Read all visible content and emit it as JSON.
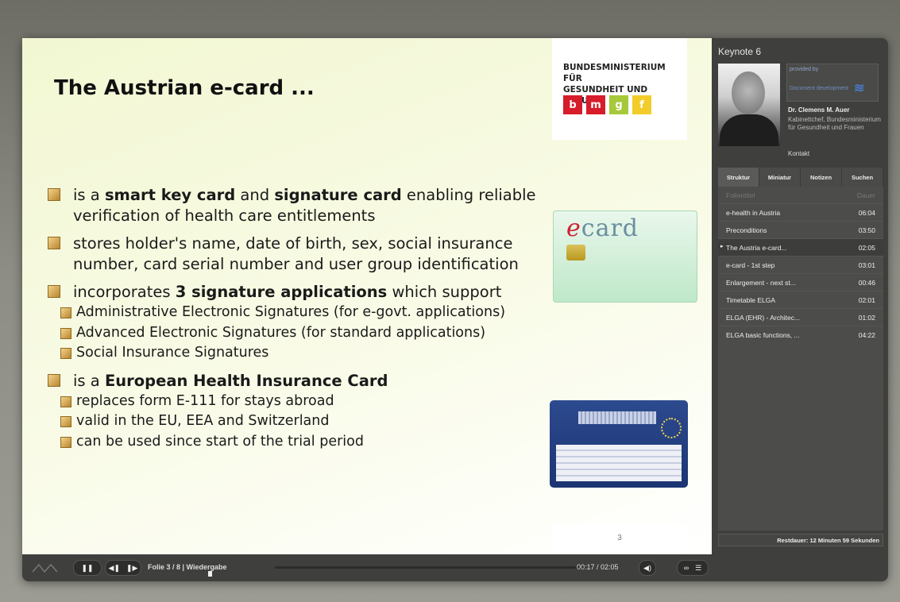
{
  "slide": {
    "title": "The Austrian e-card ...",
    "logo": {
      "line1": "BUNDESMINISTERIUM FÜR",
      "line2": "GESUNDHEIT UND FRAUEN",
      "letters": [
        {
          "t": "b",
          "color": "#d71c2a"
        },
        {
          "t": "m",
          "color": "#d71c2a"
        },
        {
          "t": "g",
          "color": "#a6c93a"
        },
        {
          "t": "f",
          "color": "#f2cc2a"
        }
      ]
    },
    "ecard_logo_e": "e",
    "ecard_logo_rest": "card",
    "page_number": "3",
    "bullets": [
      {
        "parts": [
          {
            "t": "is a "
          },
          {
            "t": "smart key card",
            "b": true
          },
          {
            "t": " and "
          },
          {
            "t": "signature card",
            "b": true
          },
          {
            "t": " enabling reliable verification of health care entitlements"
          }
        ],
        "subs": []
      },
      {
        "parts": [
          {
            "t": "stores holder's name, date of birth, sex, social insurance number, card serial number and user group identification"
          }
        ],
        "subs": []
      },
      {
        "parts": [
          {
            "t": "incorporates "
          },
          {
            "t": "3 signature applications",
            "b": true
          },
          {
            "t": " which support"
          }
        ],
        "subs": [
          "Administrative Electronic Signatures (for e-govt. applications)",
          "Advanced Electronic Signatures (for standard applications)",
          "Social Insurance Signatures"
        ]
      },
      {
        "parts": [
          {
            "t": "is a "
          },
          {
            "t": "European Health Insurance Card",
            "b": true
          }
        ],
        "subs": [
          "replaces form E-111 for stays abroad",
          "valid in the EU, EEA and Switzerland",
          "can be used since start of the trial period"
        ]
      }
    ]
  },
  "controls": {
    "slide_info": "Folie 3 / 8 | Wiedergabe",
    "time": "00:17 / 02:05",
    "pause_icon": "pause-icon",
    "prev_icon": "prev-icon",
    "next_icon": "next-icon",
    "volume_icon": "volume-icon",
    "link_icon": "link-icon",
    "menu_icon": "menu-icon",
    "logo_icon": "mediasite-logo-icon"
  },
  "sidebar": {
    "title": "Keynote 6",
    "provider_label": "provided by",
    "provider_name": "Document development",
    "speaker_name": "Dr. Clemens M. Auer",
    "speaker_role": "Kabinettchef, Bundesministerium für Gesundheit und Frauen",
    "contact": "Kontakt",
    "tabs": [
      "Struktur",
      "Miniatur",
      "Notizen",
      "Suchen"
    ],
    "list_header": {
      "title": "Folientitel",
      "time": "Dauer"
    },
    "items": [
      {
        "title": "e-health in Austria",
        "time": "06:04",
        "active": false
      },
      {
        "title": "Preconditions",
        "time": "03:50",
        "active": false
      },
      {
        "title": "The Austria e-card...",
        "time": "02:05",
        "active": true
      },
      {
        "title": "e-card - 1st step",
        "time": "03:01",
        "active": false
      },
      {
        "title": "Enlargement - next st...",
        "time": "00:46",
        "active": false
      },
      {
        "title": "Timetable ELGA",
        "time": "02:01",
        "active": false
      },
      {
        "title": "ELGA (EHR) - Architec...",
        "time": "01:02",
        "active": false
      },
      {
        "title": "ELGA basic functions, ...",
        "time": "04:22",
        "active": false
      }
    ],
    "remaining": "Restdauer: 12 Minuten 59 Sekunden"
  }
}
